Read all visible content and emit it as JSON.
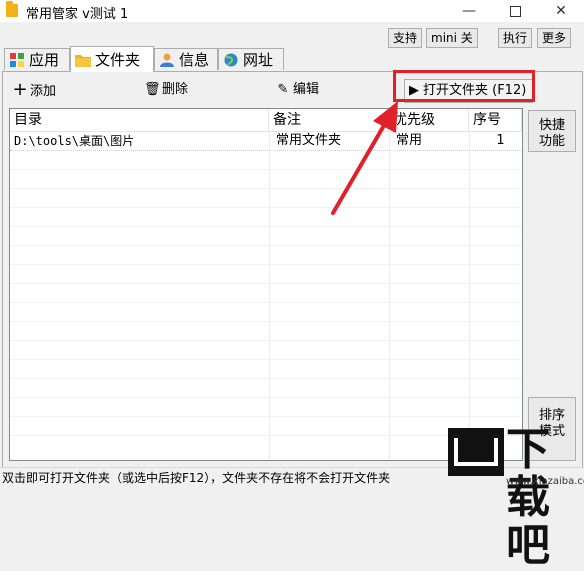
{
  "window": {
    "title": "常用管家 v测试 1",
    "minimize": "—",
    "close": "✕"
  },
  "top_buttons": {
    "support": "支持",
    "mini": "mini 关",
    "execute": "执行",
    "more": "更多"
  },
  "tabs": [
    {
      "label": "应用",
      "icon": "apps-icon"
    },
    {
      "label": "文件夹",
      "icon": "folder-icon"
    },
    {
      "label": "信息",
      "icon": "user-icon"
    },
    {
      "label": "网址",
      "icon": "globe-icon"
    }
  ],
  "toolbar": {
    "add": "添加",
    "delete": "删除",
    "edit": "编辑",
    "open_folder": "打开文件夹 (F12)"
  },
  "table": {
    "headers": [
      "目录",
      "备注",
      "优先级",
      "序号"
    ],
    "rows": [
      [
        "D:\\tools\\桌面\\图片",
        "常用文件夹",
        "常用",
        "1"
      ]
    ]
  },
  "side": {
    "quick": "快捷功能",
    "sort": "排序模式"
  },
  "status": "双击即可打开文件夹（或选中后按F12），文件夹不存在将不会打开文件夹",
  "watermark": {
    "text": "下载吧",
    "url": "www.xiazaiba.com"
  },
  "colors": {
    "highlight": "#e0202a",
    "folder": "#f3b21a"
  }
}
